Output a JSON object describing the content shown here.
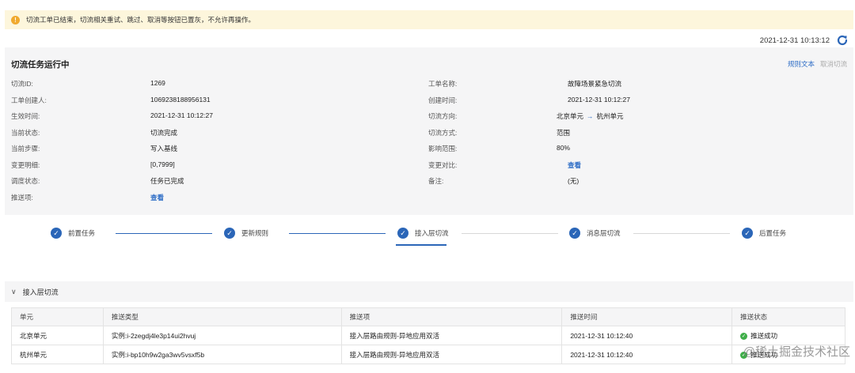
{
  "alert": {
    "icon": "warning-icon",
    "text": "切流工单已结束，切流相关重试、跳过、取消等按钮已置灰，不允许再操作。"
  },
  "header": {
    "timestamp": "2021-12-31 10:13:12",
    "refresh_icon": "refresh-icon"
  },
  "panel": {
    "title": "切流任务运行中",
    "actions": {
      "rules_text": "规则文本",
      "cancel": "取消切流"
    },
    "left_fields": [
      {
        "label": "切流ID:",
        "value": "1269"
      },
      {
        "label": "工单创建人:",
        "value": "1069238188956131"
      },
      {
        "label": "生效时间:",
        "value": "2021-12-31 10:12:27"
      },
      {
        "label": "当前状态:",
        "value": "切流完成"
      },
      {
        "label": "当前步骤:",
        "value": "写入基线"
      },
      {
        "label": "变更明细:",
        "value": "[0,7999]"
      },
      {
        "label": "调度状态:",
        "value": "任务已完成"
      },
      {
        "label": "推送项:",
        "value": "查看"
      }
    ],
    "right_fields": [
      {
        "label": "工单名称:",
        "value": "故障场景紧急切流"
      },
      {
        "label": "创建时间:",
        "value": "2021-12-31 10:12:27"
      },
      {
        "label": "切流方向:",
        "from": "北京单元",
        "to": "杭州单元"
      },
      {
        "label": "切流方式:",
        "value": "范围"
      },
      {
        "label": "影响范围:",
        "value": "80%"
      },
      {
        "label": "变更对比:",
        "value": "查看"
      },
      {
        "label": "备注:",
        "value": "(无)"
      }
    ]
  },
  "steps": [
    "前置任务",
    "更新规则",
    "接入层切流",
    "消息层切流",
    "后置任务"
  ],
  "section": {
    "title": "接入层切流"
  },
  "table": {
    "headers": [
      "单元",
      "推送类型",
      "推送项",
      "推送时间",
      "推送状态"
    ],
    "rows": [
      [
        "北京单元",
        "实例:i-2zegdj4le3p14ui2hvuj",
        "接入层路由规则-异地应用双活",
        "2021-12-31 10:12:40",
        "推送成功"
      ],
      [
        "杭州单元",
        "实例:i-bp10h9w2ga3wv5vsxf5b",
        "接入层路由规则-异地应用双活",
        "2021-12-31 10:12:40",
        "推送成功"
      ]
    ]
  },
  "watermark": "@稀土掘金技术社区",
  "colors": {
    "primary": "#2b66b8",
    "link": "#2b6bc5",
    "warning": "#f0a92e",
    "success": "#3fae49",
    "alert_bg": "#fdf6dc"
  }
}
